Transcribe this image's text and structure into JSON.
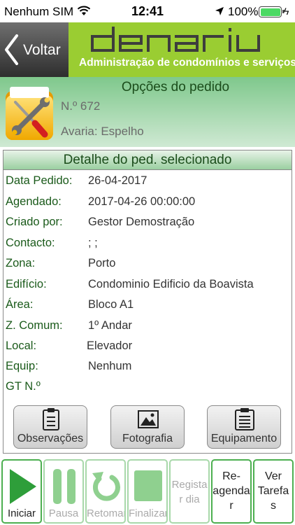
{
  "status_bar": {
    "carrier": "Nenhum SIM",
    "time": "12:41",
    "battery_percent": "100%",
    "battery_level": 1.0,
    "battery_color": "#4cd964"
  },
  "header": {
    "back_label": "Voltar",
    "brand": "denariu",
    "tagline": "Administração de condomínios e serviços",
    "accent_color": "#9acd32"
  },
  "order": {
    "title": "Opções do pedido",
    "number": "N.º 672",
    "fault": "Avaria: Espelho",
    "icon": "tools-folder-icon"
  },
  "detail": {
    "title": "Detalhe do ped. selecionado",
    "fields": [
      {
        "label": "Data Pedido:",
        "value": "26-04-2017"
      },
      {
        "label": "Agendado:",
        "value": "2017-04-26 00:00:00"
      },
      {
        "label": "Criado por:",
        "value": "Gestor Demostração"
      },
      {
        "label": "Contacto:",
        "value": "; ;"
      },
      {
        "label": "Zona:",
        "value": "Porto"
      },
      {
        "label": "Edifício:",
        "value": "Condominio Edificio da Boavista"
      },
      {
        "label": "Área:",
        "value": "Bloco A1"
      },
      {
        "label": "Z. Comum:",
        "value": "1º Andar"
      },
      {
        "label": "Local:",
        "value": "Elevador"
      },
      {
        "label": "Equip:",
        "value": "Nenhum"
      },
      {
        "label": "GT N.º",
        "value": ""
      }
    ],
    "actions": [
      {
        "label": "Observações",
        "icon": "clipboard-icon"
      },
      {
        "label": "Fotografia",
        "icon": "picture-icon"
      },
      {
        "label": "Equipamento",
        "icon": "clipboard-list-icon"
      }
    ]
  },
  "toolbar": {
    "buttons": [
      {
        "label": "Iniciar",
        "icon": "play-icon",
        "enabled": true
      },
      {
        "label": "Pausa",
        "icon": "pause-icon",
        "enabled": false
      },
      {
        "label": "Retomar",
        "icon": "resume-icon",
        "enabled": false
      },
      {
        "label": "Finalizar",
        "icon": "stop-icon",
        "enabled": false
      },
      {
        "label": "Registar dia",
        "lines": [
          "Regista",
          "r dia"
        ],
        "enabled": false
      },
      {
        "label": "Re-agendar",
        "lines": [
          "Re-",
          "agenda",
          "r"
        ],
        "enabled": true
      },
      {
        "label": "Ver Tarefas",
        "lines": [
          "Ver",
          "Tarefa",
          "s"
        ],
        "enabled": true
      }
    ]
  }
}
